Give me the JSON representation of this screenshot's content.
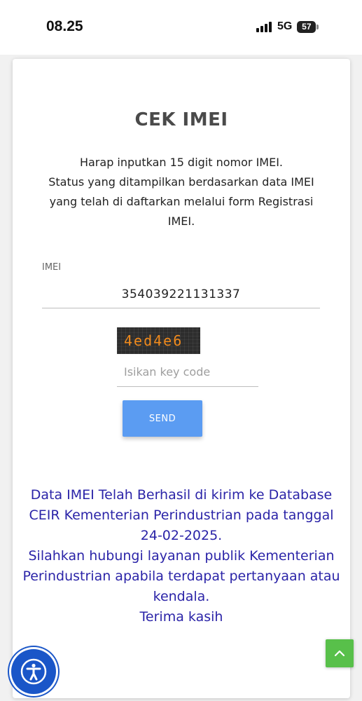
{
  "status_bar": {
    "time": "08.25",
    "network": "5G",
    "battery": "57"
  },
  "form": {
    "title": "CEK IMEI",
    "description": [
      "Harap inputkan 15 digit nomor IMEI.",
      "Status yang ditampilkan berdasarkan data IMEI yang telah di daftarkan melalui form Registrasi IMEI."
    ],
    "imei_label": "IMEI",
    "imei_value": "354039221131337",
    "captcha_text": "4ed4e6",
    "keycode_placeholder": "Isikan key code",
    "send_label": "SEND"
  },
  "result": {
    "lines": [
      "Data IMEI Telah Berhasil di kirim ke Database CEIR Kementerian Perindustrian pada tanggal 24-02-2025.",
      "Silahkan hubungi layanan publik Kementerian Perindustrian apabila terdapat pertanyaan atau kendala.",
      "Terima kasih"
    ],
    "color": "#2b24a8"
  },
  "icons": {
    "scroll_top": "chevron-up-icon",
    "accessibility": "accessibility-icon"
  },
  "colors": {
    "send_button": "#5b9cf2",
    "scroll_top_button": "#58c04a",
    "accessibility_button": "#1a56c8"
  }
}
